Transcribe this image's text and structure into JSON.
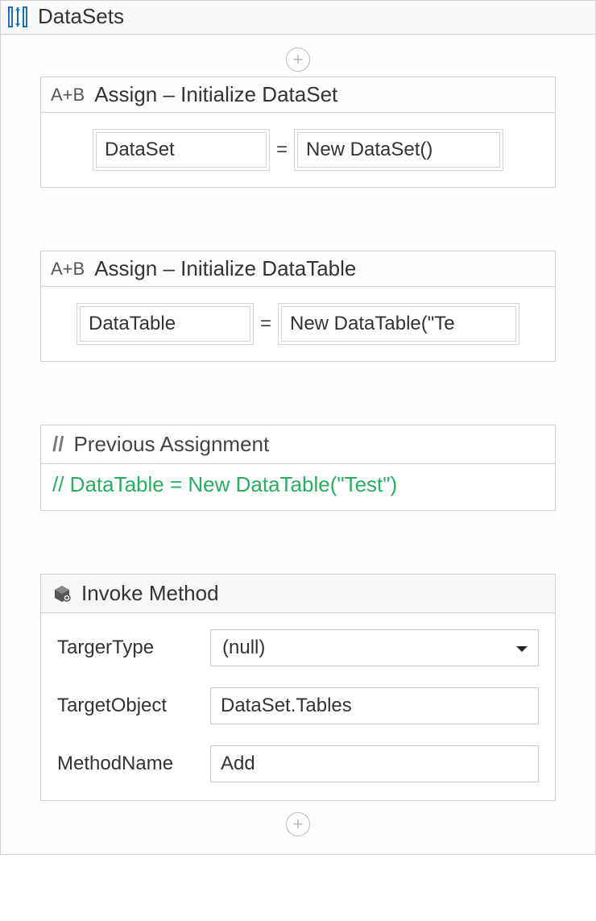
{
  "workflow": {
    "title": "DataSets",
    "icons": {
      "sequence": "sequence-icon",
      "plus": "+"
    },
    "activities": {
      "assign1": {
        "prefix": "A+B",
        "title": "Assign – Initialize DataSet",
        "to": "DataSet",
        "value": "New DataSet()"
      },
      "assign2": {
        "prefix": "A+B",
        "title": "Assign – Initialize DataTable",
        "to": "DataTable",
        "value": "New DataTable(\"Te"
      },
      "comment": {
        "prefix": "//",
        "title": "Previous Assignment",
        "body": "// DataTable = New DataTable(\"Test\")"
      },
      "invoke": {
        "title": "Invoke Method",
        "fields": {
          "targerType": {
            "label": "TargerType",
            "value": "(null)"
          },
          "targetObject": {
            "label": "TargetObject",
            "value": "DataSet.Tables"
          },
          "methodName": {
            "label": "MethodName",
            "value": "Add"
          }
        }
      }
    }
  }
}
